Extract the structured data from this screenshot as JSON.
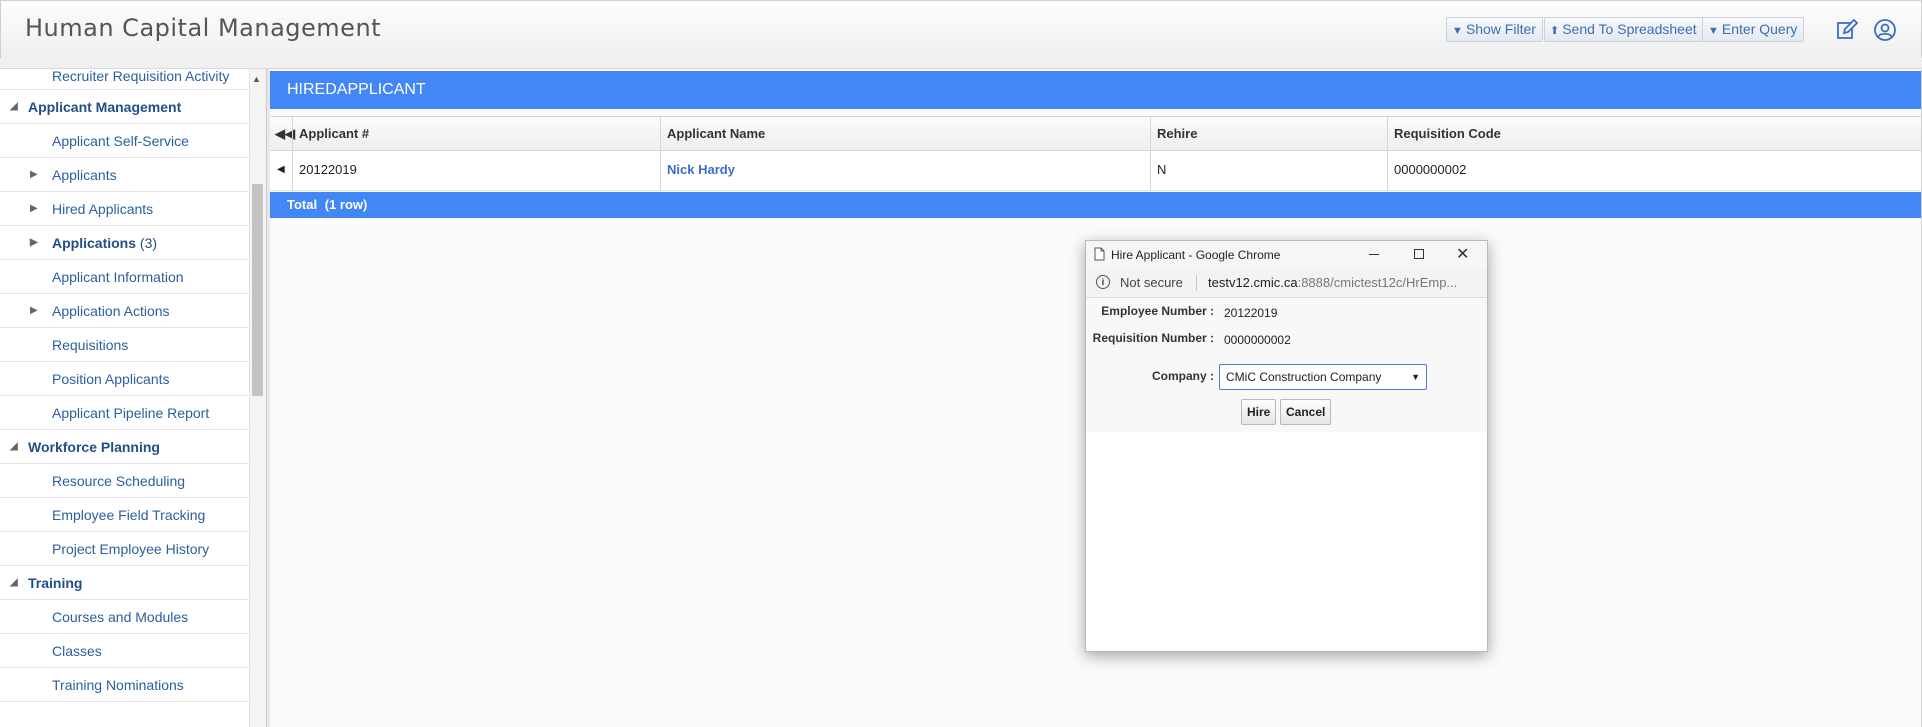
{
  "header": {
    "title": "Human Capital Management",
    "buttons": {
      "show_filter": "Show Filter",
      "send_to_spreadsheet": "Send To Spreadsheet",
      "enter_query": "Enter Query"
    },
    "icons": [
      "edit-icon",
      "user-icon"
    ]
  },
  "sidebar": {
    "items": [
      {
        "label": "Recruiter Requisition Activity",
        "kind": "sub"
      },
      {
        "label": "Applicant Management",
        "kind": "group"
      },
      {
        "label": "Applicant Self-Service",
        "kind": "sub"
      },
      {
        "label": "Applicants",
        "kind": "sub-expandable"
      },
      {
        "label": "Hired Applicants",
        "kind": "sub-expandable"
      },
      {
        "label": "Applications",
        "count": "(3)",
        "kind": "sub-expandable-bold"
      },
      {
        "label": "Applicant Information",
        "kind": "sub"
      },
      {
        "label": "Application Actions",
        "kind": "sub-expandable"
      },
      {
        "label": "Requisitions",
        "kind": "sub"
      },
      {
        "label": "Position Applicants",
        "kind": "sub"
      },
      {
        "label": "Applicant Pipeline Report",
        "kind": "sub"
      },
      {
        "label": "Workforce Planning",
        "kind": "group"
      },
      {
        "label": "Resource Scheduling",
        "kind": "sub"
      },
      {
        "label": "Employee Field Tracking",
        "kind": "sub"
      },
      {
        "label": "Project Employee History",
        "kind": "sub"
      },
      {
        "label": "Training",
        "kind": "group"
      },
      {
        "label": "Courses and Modules",
        "kind": "sub"
      },
      {
        "label": "Classes",
        "kind": "sub"
      },
      {
        "label": "Training Nominations",
        "kind": "sub"
      }
    ]
  },
  "main": {
    "panel_title": "HIREDAPPLICANT",
    "columns": [
      "Applicant #",
      "Applicant Name",
      "Rehire",
      "Requisition Code"
    ],
    "rows": [
      {
        "applicant_no": "20122019",
        "applicant_name": "Nick Hardy",
        "rehire": "N",
        "requisition_code": "0000000002"
      }
    ],
    "total_label": "Total",
    "total_count": "(1 row)"
  },
  "popup": {
    "window_title": "Hire Applicant - Google Chrome",
    "security": "Not secure",
    "url_host": "testv12.cmic.ca",
    "url_rest": ":8888/cmictest12c/HrEmp...",
    "fields": {
      "employee_number_label": "Employee Number :",
      "employee_number": "20122019",
      "requisition_number_label": "Requisition Number :",
      "requisition_number": "0000000002",
      "company_label": "Company :",
      "company": "CMiC Construction Company"
    },
    "buttons": {
      "hire": "Hire",
      "cancel": "Cancel"
    }
  },
  "colors": {
    "accent": "#4287f5",
    "link": "#2b5f9e"
  }
}
